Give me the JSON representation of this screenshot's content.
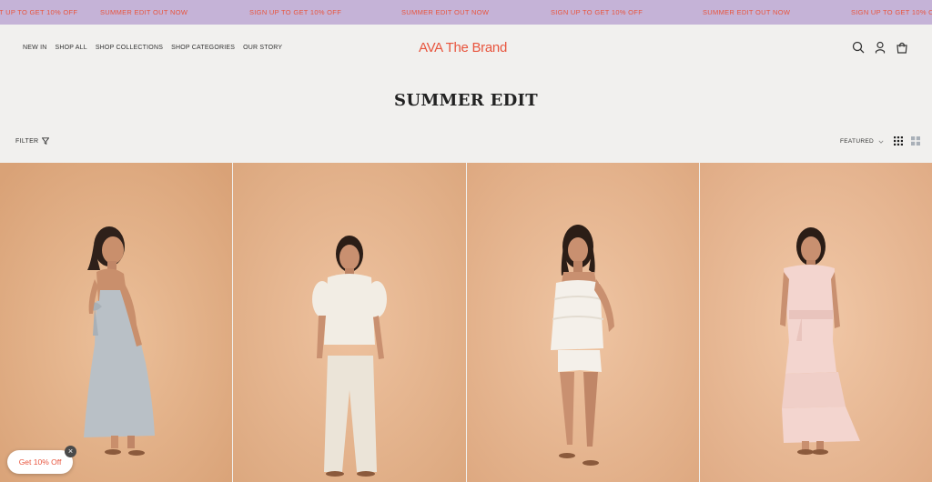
{
  "announcement": {
    "messages": [
      "T UP TO GET 10% OFF",
      "SUMMER EDIT OUT NOW",
      "SIGN UP TO GET 10% OFF",
      "SUMMER EDIT OUT NOW",
      "SIGN UP TO GET 10% OFF",
      "SUMMER EDIT OUT NOW",
      "SIGN UP TO GET 10% OFF"
    ],
    "text_color": "#e8553e",
    "background": "#c5b3d7"
  },
  "nav": {
    "items": [
      "NEW IN",
      "SHOP ALL",
      "SHOP COLLECTIONS",
      "SHOP CATEGORIES",
      "OUR STORY"
    ]
  },
  "brand": {
    "logo_text": "AVA The Brand",
    "color": "#e8553e"
  },
  "header_icons": [
    "search-icon",
    "account-icon",
    "bag-icon"
  ],
  "page": {
    "title": "SUMMER EDIT"
  },
  "toolbar": {
    "filter_label": "FILTER",
    "sort_label": "FEATURED",
    "view_options": [
      "grid-4-icon",
      "grid-2-icon"
    ]
  },
  "products": [
    {
      "outfit": "light blue dress",
      "garment_color": "#b9c0c6"
    },
    {
      "outfit": "white puff-sleeve top and trousers",
      "garment_color": "#f2ede4"
    },
    {
      "outfit": "white ruffled top and shorts",
      "garment_color": "#f4f0ea"
    },
    {
      "outfit": "pink top and tiered skirt",
      "garment_color": "#f3d5cf"
    }
  ],
  "promo": {
    "label": "Get 10% Off",
    "close_glyph": "×"
  }
}
